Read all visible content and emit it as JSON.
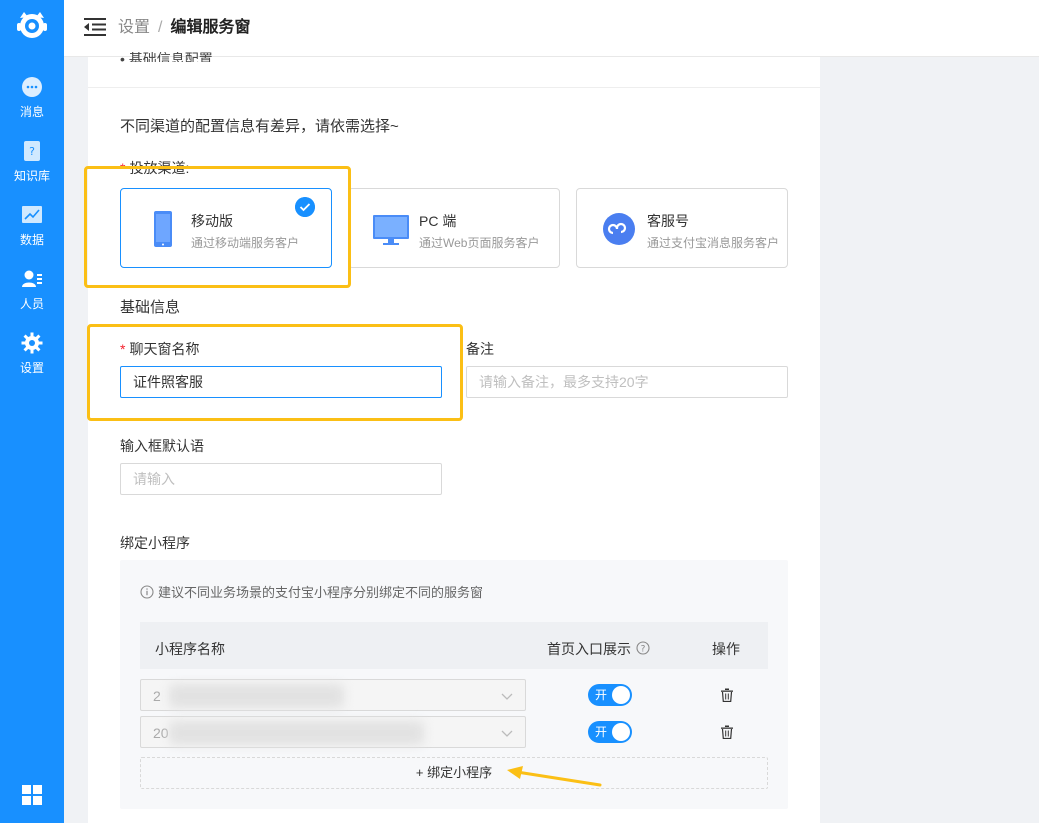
{
  "sidebar": {
    "items": [
      {
        "label": "消息",
        "icon": "chat-bubble-icon"
      },
      {
        "label": "知识库",
        "icon": "knowledge-book-icon"
      },
      {
        "label": "数据",
        "icon": "line-chart-icon"
      },
      {
        "label": "人员",
        "icon": "people-icon"
      },
      {
        "label": "设置",
        "icon": "gear-icon"
      }
    ]
  },
  "header": {
    "breadcrumb_parent": "设置",
    "breadcrumb_sep": "/",
    "breadcrumb_current": "编辑服务窗"
  },
  "form": {
    "collapsed_section_title": "• 基础信息配置",
    "hint": "不同渠道的配置信息有差异，请依需选择~",
    "channel_label": "投放渠道:",
    "channels": [
      {
        "title": "移动版",
        "desc": "通过移动端服务客户",
        "selected": true
      },
      {
        "title": "PC 端",
        "desc": "通过Web页面服务客户",
        "selected": false
      },
      {
        "title": "客服号",
        "desc": "通过支付宝消息服务客户",
        "selected": false
      }
    ],
    "basic_info_title": "基础信息",
    "chat_name_label": "聊天窗名称",
    "chat_name_value": "证件照客服",
    "remark_label": "备注",
    "remark_placeholder": "请输入备注，最多支持20字",
    "default_input_label": "输入框默认语",
    "default_input_placeholder": "请输入",
    "bind_title": "绑定小程序",
    "bind_tip": "建议不同业务场景的支付宝小程序分别绑定不同的服务窗",
    "table": {
      "col_name": "小程序名称",
      "col_show": "首页入口展示",
      "col_action": "操作"
    },
    "rows": [
      {
        "prefix": "2",
        "switch_text": "开"
      },
      {
        "prefix": "20",
        "switch_text": "开"
      }
    ],
    "add_button": "+ 绑定小程序"
  },
  "colors": {
    "primary": "#1890ff",
    "highlight": "#fbbf15",
    "required": "#f5222d"
  }
}
